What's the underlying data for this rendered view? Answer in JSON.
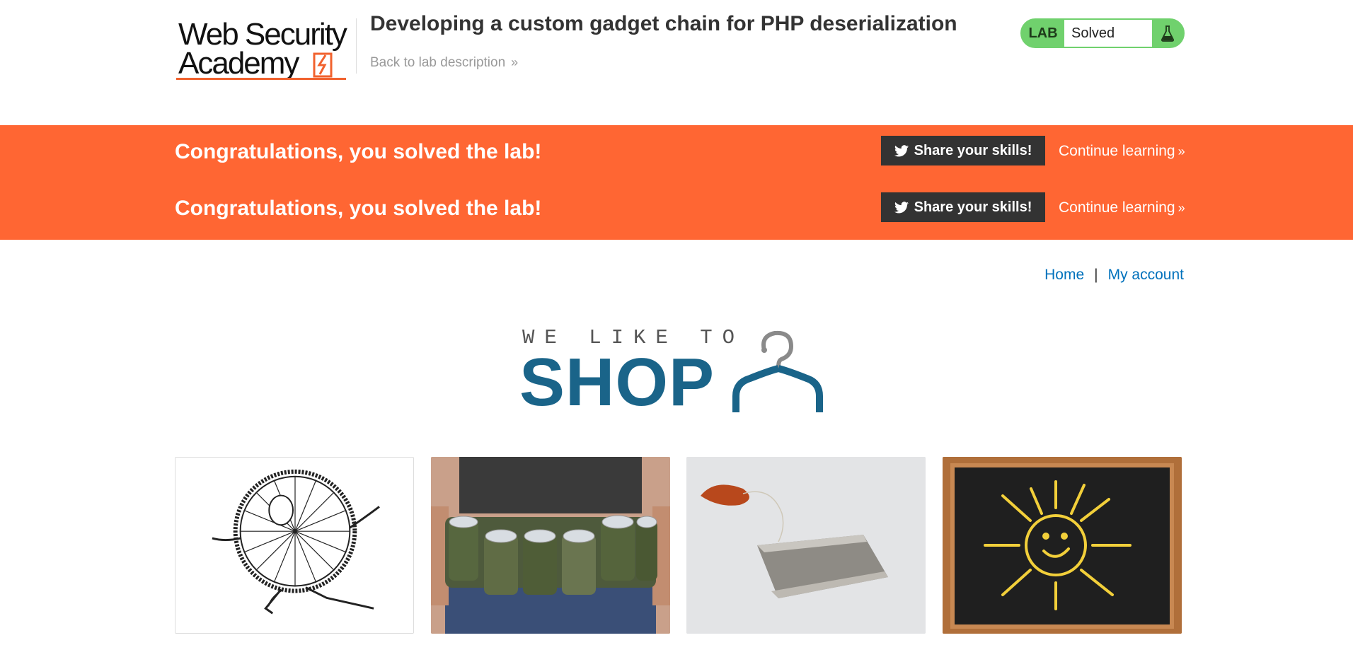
{
  "header": {
    "logo_line1": "Web Security",
    "logo_line2": "Academy",
    "lab_title": "Developing a custom gadget chain for PHP deserialization",
    "back_link": "Back to lab description",
    "back_chevron": "»",
    "lab_tag": "LAB",
    "lab_status": "Solved"
  },
  "notification": {
    "rows": [
      {
        "message": "Congratulations, you solved the lab!",
        "share_label": "Share your skills!",
        "continue_label": "Continue learning",
        "chevron": "»"
      },
      {
        "message": "Congratulations, you solved the lab!",
        "share_label": "Share your skills!",
        "continue_label": "Continue learning",
        "chevron": "»"
      }
    ],
    "banner_color": "#ff6633"
  },
  "nav": {
    "home": "Home",
    "separator": "|",
    "my_account": "My account"
  },
  "hero": {
    "tagline": "WE LIKE TO",
    "title": "SHOP"
  },
  "products": [
    {
      "icon": "sun-costume-illustration"
    },
    {
      "icon": "beer-belt-photo"
    },
    {
      "icon": "tea-bag-photo"
    },
    {
      "icon": "sun-chalkboard-photo"
    }
  ],
  "colors": {
    "accent": "#ff6633",
    "link": "#0071bc",
    "solved": "#70d16d",
    "shop_title": "#1a6489"
  }
}
